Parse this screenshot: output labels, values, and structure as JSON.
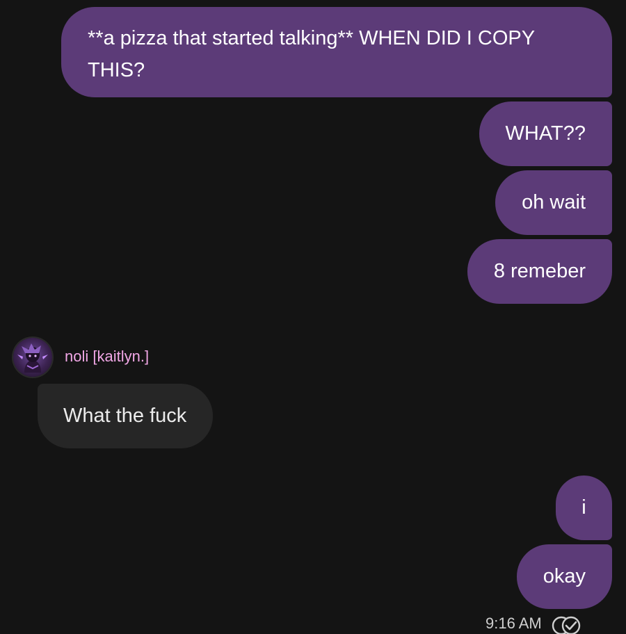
{
  "messages": [
    {
      "text": "**a pizza that started talking** WHEN DID I COPY THIS?",
      "direction": "outgoing"
    },
    {
      "text": "WHAT??",
      "direction": "outgoing"
    },
    {
      "text": "oh wait",
      "direction": "outgoing"
    },
    {
      "text": "8 remeber",
      "direction": "outgoing"
    },
    {
      "text": "What the fuck",
      "direction": "incoming"
    },
    {
      "text": "i",
      "direction": "outgoing"
    },
    {
      "text": "okay",
      "direction": "outgoing"
    }
  ],
  "contact": {
    "name": "noli [kaitlyn.]",
    "name_color": "#f1a7e6"
  },
  "status": {
    "time": "9:16 AM",
    "read_icon": "double-check-circle-icon"
  },
  "colors": {
    "background": "#141414",
    "outgoing_bubble": "#5c3b78",
    "incoming_bubble": "#262626"
  }
}
